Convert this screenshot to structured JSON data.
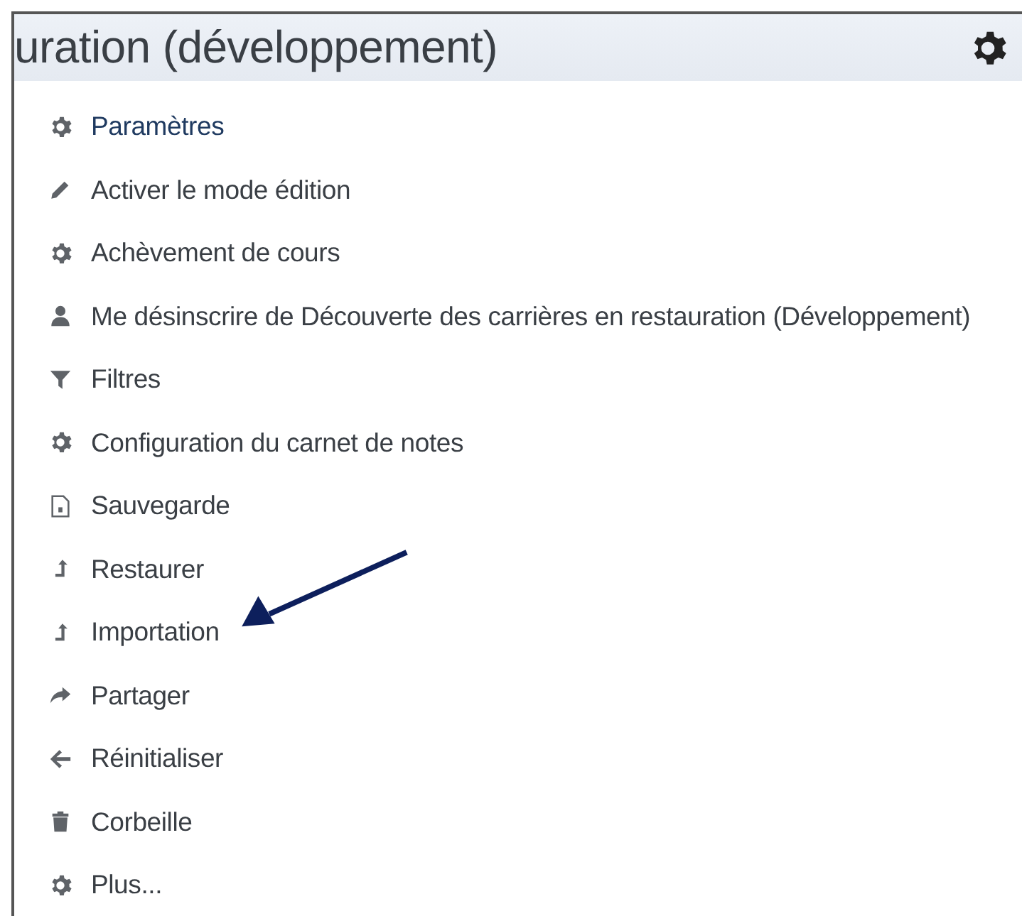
{
  "header": {
    "title": "uration (développement)"
  },
  "menu": [
    {
      "label": "Paramètres",
      "kind": "gear",
      "selected": true
    },
    {
      "label": "Activer le mode édition",
      "kind": "pencil",
      "selected": false
    },
    {
      "label": "Achèvement de cours",
      "kind": "gear",
      "selected": false
    },
    {
      "label": "Me désinscrire de Découverte des carrières en restauration (Développement)",
      "kind": "user",
      "selected": false
    },
    {
      "label": "Filtres",
      "kind": "filter",
      "selected": false
    },
    {
      "label": "Configuration du carnet de notes",
      "kind": "gear",
      "selected": false
    },
    {
      "label": "Sauvegarde",
      "kind": "file",
      "selected": false
    },
    {
      "label": "Restaurer",
      "kind": "upload",
      "selected": false
    },
    {
      "label": "Importation",
      "kind": "upload",
      "selected": false
    },
    {
      "label": "Partager",
      "kind": "share",
      "selected": false
    },
    {
      "label": "Réinitialiser",
      "kind": "back",
      "selected": false
    },
    {
      "label": "Corbeille",
      "kind": "trash",
      "selected": false
    },
    {
      "label": "Plus...",
      "kind": "gear",
      "selected": false
    }
  ]
}
